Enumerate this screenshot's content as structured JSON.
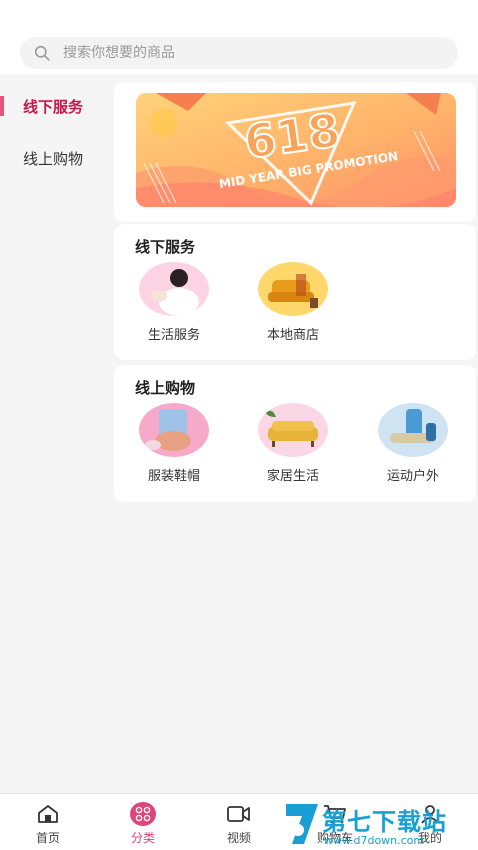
{
  "search": {
    "placeholder": "搜索你想要的商品"
  },
  "sidebar": {
    "items": [
      {
        "label": "线下服务",
        "active": true
      },
      {
        "label": "线上购物",
        "active": false
      }
    ]
  },
  "banner": {
    "big_text": "618",
    "sub_text": "MID YEAR BIG PROMOTION"
  },
  "sections": [
    {
      "title": "线下服务",
      "items": [
        {
          "label": "生活服务",
          "icon": "massage-photo"
        },
        {
          "label": "本地商店",
          "icon": "sofa-shop-photo"
        }
      ]
    },
    {
      "title": "线上购物",
      "items": [
        {
          "label": "服装鞋帽",
          "icon": "clothing-photo"
        },
        {
          "label": "家居生活",
          "icon": "sofa-photo"
        },
        {
          "label": "运动户外",
          "icon": "outdoor-gear-photo"
        }
      ]
    }
  ],
  "tabbar": {
    "items": [
      {
        "label": "首页",
        "icon": "home-icon",
        "active": false
      },
      {
        "label": "分类",
        "icon": "category-icon",
        "active": true
      },
      {
        "label": "视频",
        "icon": "video-icon",
        "active": false
      },
      {
        "label": "购物车",
        "icon": "cart-icon",
        "active": false
      },
      {
        "label": "我的",
        "icon": "user-icon",
        "active": false
      }
    ]
  },
  "watermark": {
    "title": "第七下载站",
    "url": "www.d7down.com"
  },
  "colors": {
    "accent": "#c9174c",
    "tab_active": "#e0457a",
    "watermark": "#1a9fd4"
  }
}
